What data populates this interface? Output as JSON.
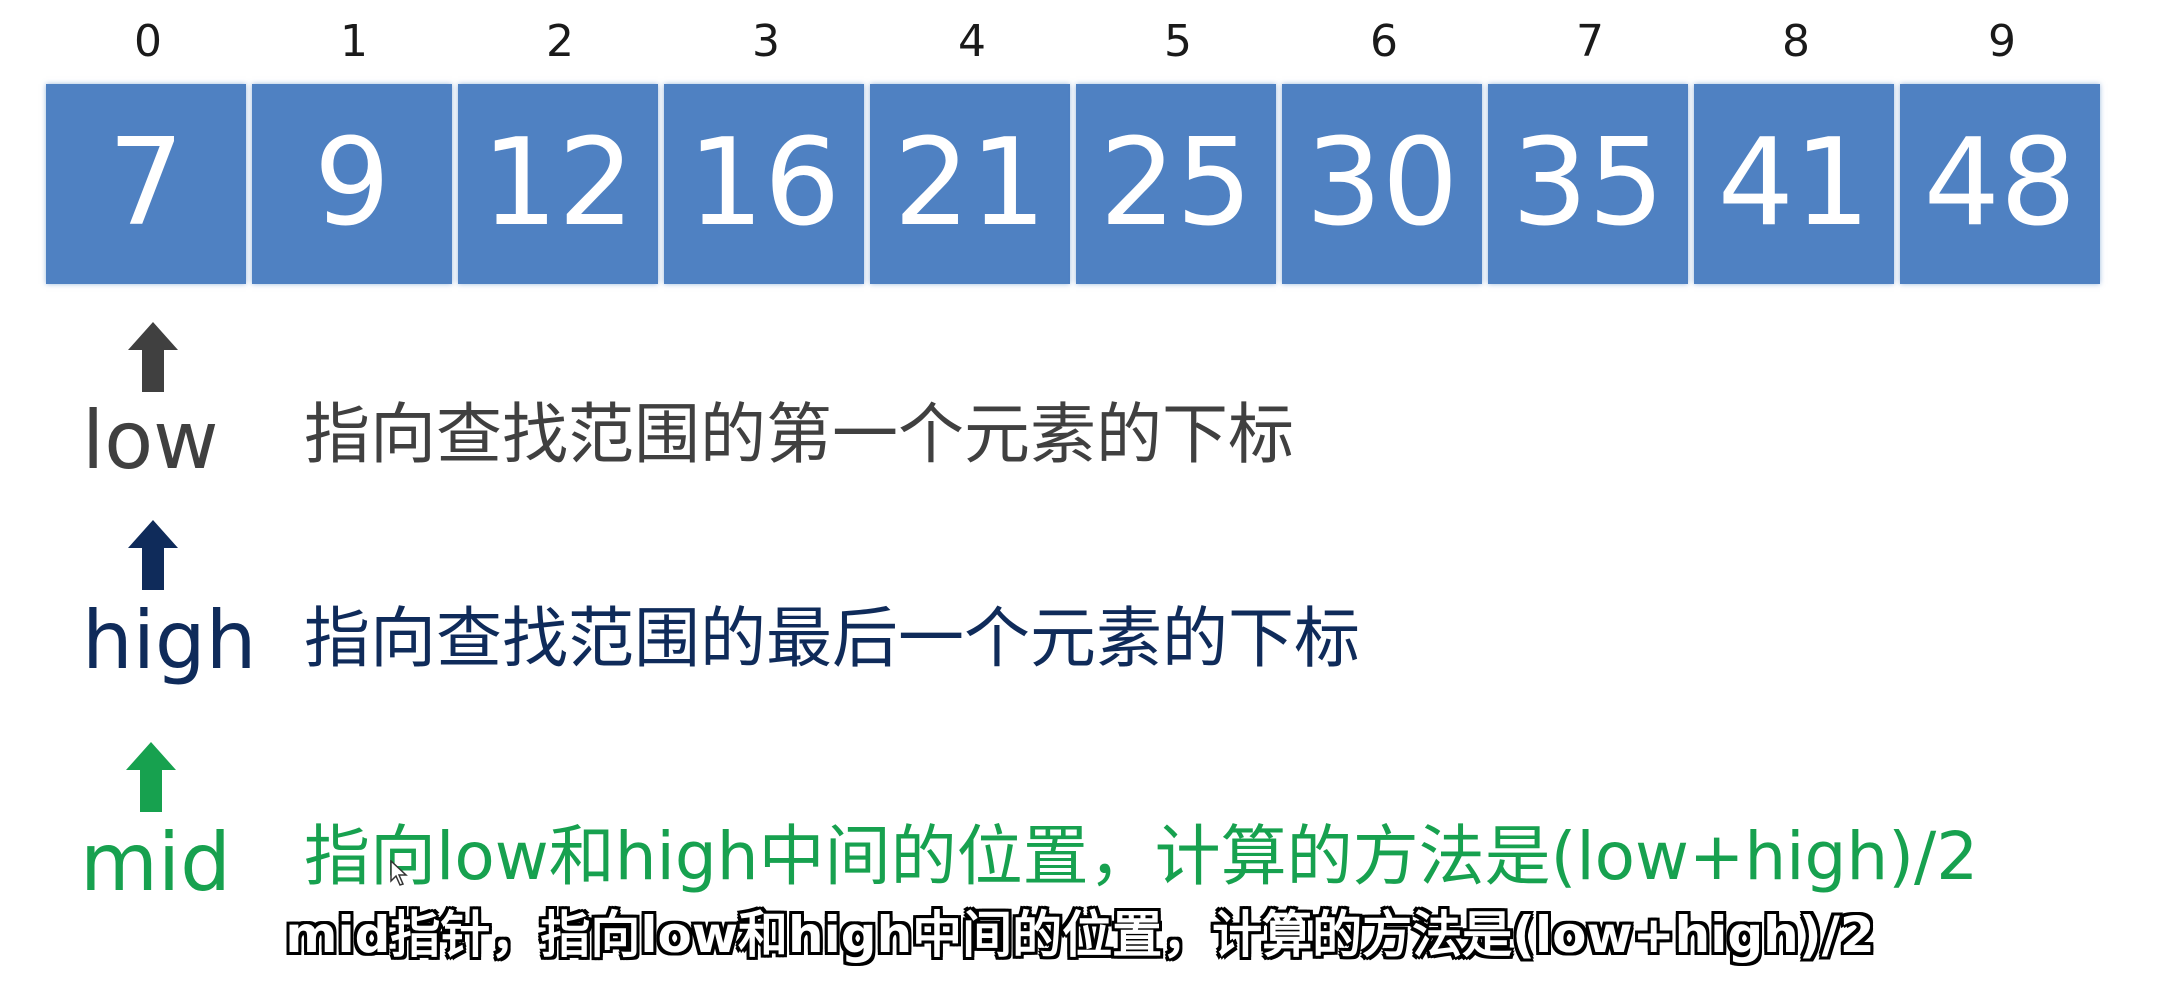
{
  "array": {
    "indices": [
      "0",
      "1",
      "2",
      "3",
      "4",
      "5",
      "6",
      "7",
      "8",
      "9"
    ],
    "values": [
      "7",
      "9",
      "12",
      "16",
      "21",
      "25",
      "30",
      "35",
      "41",
      "48"
    ],
    "cell_color": "#4f81c2"
  },
  "pointers": {
    "low": {
      "label": "low",
      "description": "指向查找范围的第一个元素的下标",
      "color": "#404040",
      "icon": "up-arrow-icon"
    },
    "high": {
      "label": "high",
      "description": "指向查找范围的最后一个元素的下标",
      "color": "#0f2b5a",
      "icon": "up-arrow-icon"
    },
    "mid": {
      "label": "mid",
      "description": "指向low和high中间的位置，计算的方法是(low+high)/2",
      "color": "#17a14f",
      "icon": "up-arrow-icon"
    }
  },
  "subtitle": {
    "text": "mid指针，指向low和high中间的位置，计算的方法是(low+high)/2"
  }
}
